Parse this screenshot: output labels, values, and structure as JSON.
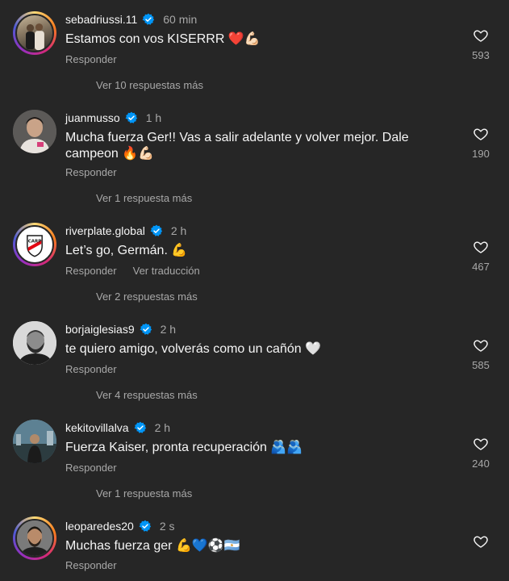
{
  "comments": [
    {
      "username": "sebadriussi.11",
      "verified": true,
      "time": "60 min",
      "text": "Estamos con vos KISERRR ❤️💪🏻",
      "reply_label": "Responder",
      "translate_label": "",
      "more_replies": "Ver 10 respuestas más",
      "likes": "593",
      "avatar": "couple-photo"
    },
    {
      "username": "juanmusso",
      "verified": true,
      "time": "1 h",
      "text": "Mucha fuerza Ger!! Vas a salir adelante y volver mejor. Dale campeon 🔥💪🏻",
      "reply_label": "Responder",
      "translate_label": "",
      "more_replies": "Ver 1 respuesta más",
      "likes": "190",
      "avatar": "man-photo"
    },
    {
      "username": "riverplate.global",
      "verified": true,
      "time": "2 h",
      "text": "Let’s go, Germán. 💪",
      "reply_label": "Responder",
      "translate_label": "Ver traducción",
      "more_replies": "Ver 2 respuestas más",
      "likes": "467",
      "avatar": "river-plate-crest"
    },
    {
      "username": "borjaiglesias9",
      "verified": true,
      "time": "2 h",
      "text": "te quiero amigo, volverás como un cañón 🤍",
      "reply_label": "Responder",
      "translate_label": "",
      "more_replies": "Ver 4 respuestas más",
      "likes": "585",
      "avatar": "bw-portrait"
    },
    {
      "username": "kekitovillalva",
      "verified": true,
      "time": "2 h",
      "text": "Fuerza Kaiser, pronta recuperación 🫂🫂",
      "reply_label": "Responder",
      "translate_label": "",
      "more_replies": "Ver 1 respuesta más",
      "likes": "240",
      "avatar": "city-photo"
    },
    {
      "username": "leoparedes20",
      "verified": true,
      "time": "2 s",
      "text": "Muchas fuerza ger 💪💙⚽🇦🇷",
      "reply_label": "Responder",
      "translate_label": "",
      "more_replies": "",
      "likes": "",
      "avatar": "man-portrait"
    }
  ],
  "colors": {
    "background": "#262626",
    "text_primary": "#f5f5f5",
    "text_secondary": "#a8a8a8",
    "verified_blue": "#0095f6"
  }
}
